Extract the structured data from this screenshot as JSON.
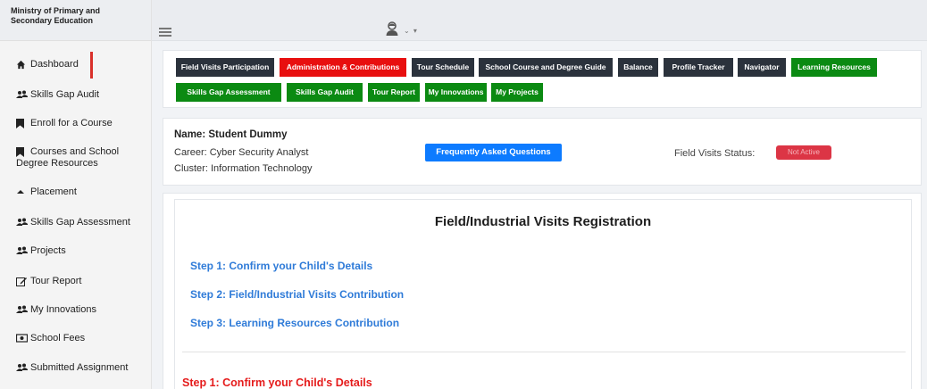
{
  "brand": {
    "line1": "Ministry of Primary and",
    "line2": "Secondary Education"
  },
  "sidebar": {
    "items": [
      {
        "label": "Dashboard",
        "icon": "home-icon"
      },
      {
        "label": "Skills Gap Audit",
        "icon": "group-icon"
      },
      {
        "label": "Enroll for a Course",
        "icon": "bookmark-icon"
      },
      {
        "label_line1": "Courses and School",
        "label_line2": "Degree Resources",
        "icon": "bookmark-icon"
      },
      {
        "label": "Placement",
        "icon": "caret-up-icon"
      },
      {
        "label": "Skills Gap Assessment",
        "icon": "group-icon"
      },
      {
        "label": "Projects",
        "icon": "group-icon"
      },
      {
        "label": "Tour Report",
        "icon": "edit-icon"
      },
      {
        "label": "My Innovations",
        "icon": "group-icon"
      },
      {
        "label": "School Fees",
        "icon": "money-icon"
      },
      {
        "label": "Submitted Assignment",
        "icon": "group-icon"
      }
    ]
  },
  "topbar": {
    "caret": "⌄ ▾"
  },
  "tabs": {
    "items": [
      {
        "label": "Field Visits Participation",
        "color": "#2b323c"
      },
      {
        "label": "Administration & Contributions",
        "color": "#e80f0f"
      },
      {
        "label": "Tour Schedule",
        "color": "#2b323c"
      },
      {
        "label": "School Course and Degree Guide",
        "color": "#2b323c"
      },
      {
        "label": "Balance",
        "color": "#2b323c"
      },
      {
        "label": "Profile Tracker",
        "color": "#2b323c"
      },
      {
        "label": "Navigator",
        "color": "#2b323c"
      },
      {
        "label": "Learning Resources",
        "color": "#0b8a12"
      },
      {
        "label": "Skills Gap Assessment",
        "color": "#0b8a12"
      },
      {
        "label": "Skills Gap Audit",
        "color": "#0b8a12"
      },
      {
        "label": "Tour Report",
        "color": "#0b8a12"
      },
      {
        "label": "My Innovations",
        "color": "#0b8a12"
      },
      {
        "label": "My Projects",
        "color": "#0b8a12"
      }
    ]
  },
  "student": {
    "name": "Name: Student Dummy",
    "career": "Career: Cyber Security Analyst",
    "cluster": "Cluster: Information Technology",
    "faq_label": "Frequently Asked Questions",
    "field_visits_label": "Field Visits Status:",
    "status": "Not Active"
  },
  "main": {
    "title": "Field/Industrial Visits Registration",
    "steps": [
      "Step 1: Confirm your Child's Details",
      "Step 2: Field/Industrial Visits Contribution",
      "Step 3: Learning Resources Contribution"
    ],
    "section_heading": "Step 1: Confirm your Child's Details"
  },
  "colors": {
    "accent_red": "#e80f0f",
    "accent_green": "#0b8a12",
    "dark": "#2b323c",
    "link_blue": "#2f7bd8",
    "faq_blue": "#0d7bff",
    "badge_red": "#dc3545"
  }
}
